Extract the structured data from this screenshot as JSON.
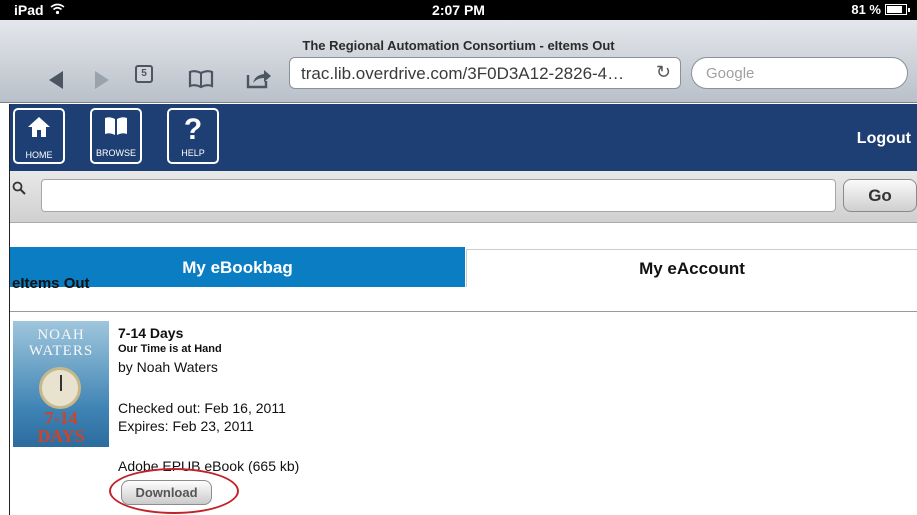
{
  "status_bar": {
    "device": "iPad",
    "wifi_icon": "wifi-icon",
    "time": "2:07 PM",
    "battery": "81 %",
    "battery_level": 0.81
  },
  "browser": {
    "page_title": "The Regional Automation Consortium - eItems Out",
    "tab_count": "5",
    "url": "trac.lib.overdrive.com/3F0D3A12-2826-4…",
    "search_placeholder": "Google"
  },
  "site_header": {
    "nav": [
      {
        "label": "HOME",
        "icon": "home-icon"
      },
      {
        "label": "BROWSE",
        "icon": "book-icon"
      },
      {
        "label": "HELP",
        "icon": "question-icon"
      }
    ],
    "logout": "Logout"
  },
  "search": {
    "go_label": "Go"
  },
  "tabs": {
    "ebookbag": "My eBookbag",
    "eaccount": "My eAccount"
  },
  "section_title": "eItems Out",
  "item": {
    "cover": {
      "author_line1": "NOAH",
      "author_line2": "WATERS",
      "title_line1": "7-14",
      "title_line2": "DAYS"
    },
    "title": "7-14 Days",
    "subtitle": "Our Time is at Hand",
    "author": "by Noah Waters",
    "checked_out": "Checked out: Feb 16, 2011",
    "expires": "Expires: Feb 23, 2011",
    "format": "Adobe EPUB eBook (665 kb)",
    "download_label": "Download"
  },
  "colors": {
    "header_blue": "#1d3f73",
    "tab_blue": "#0b7dc3",
    "highlight_red": "#c0232a"
  }
}
